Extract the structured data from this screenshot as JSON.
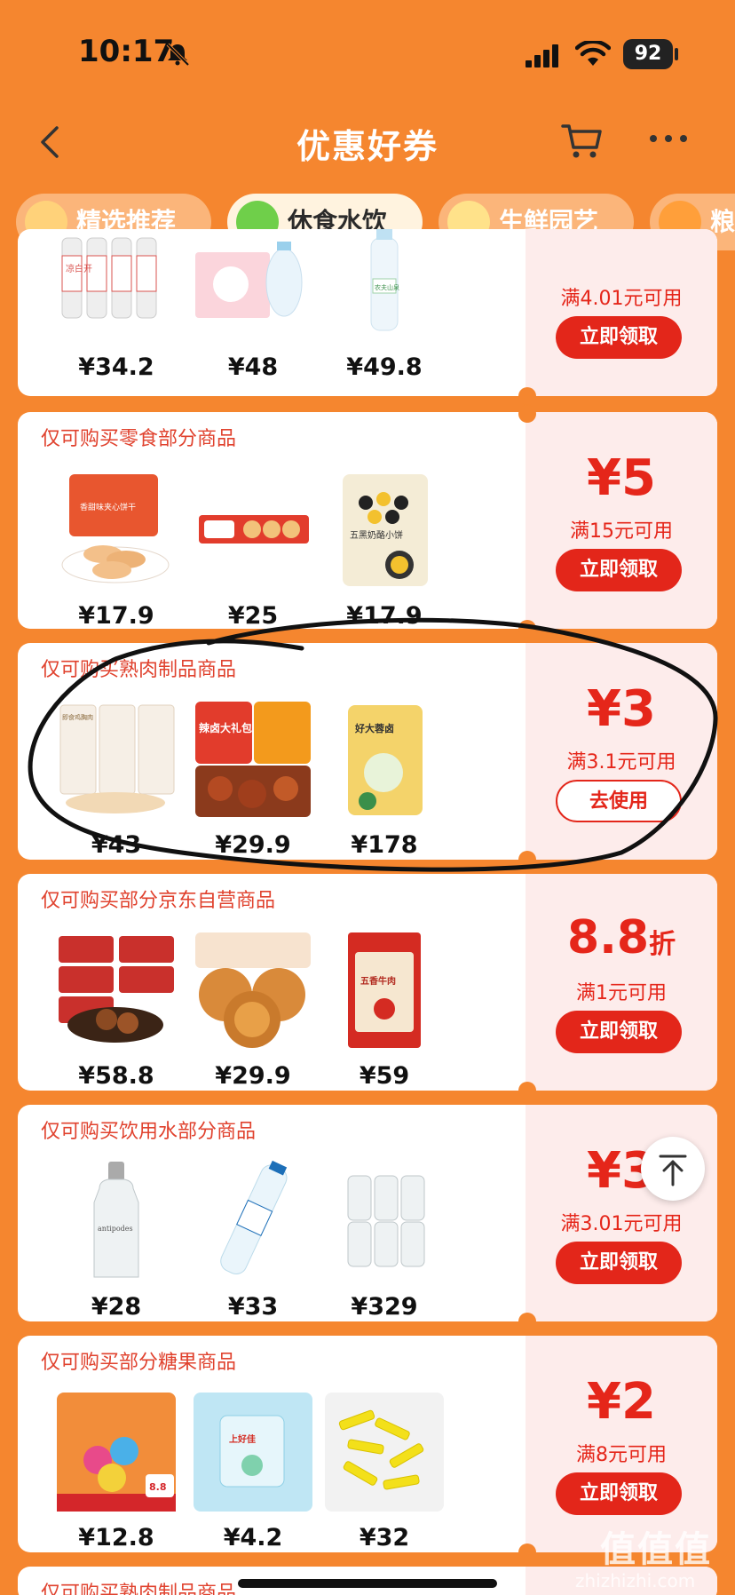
{
  "status_bar": {
    "time": "10:17",
    "battery": "92"
  },
  "nav": {
    "title": "优惠好券"
  },
  "tabs": [
    {
      "label": "精选推荐",
      "active": false
    },
    {
      "label": "休食水饮",
      "active": true
    },
    {
      "label": "生鲜园艺",
      "active": false
    },
    {
      "label": "粮",
      "active": false
    }
  ],
  "cards": [
    {
      "title": "",
      "prices": [
        "¥34.2",
        "¥48",
        "¥49.8"
      ],
      "amount": "",
      "amount_unit": "",
      "condition": "满4.01元可用",
      "button": "立即领取",
      "button_type": "claim"
    },
    {
      "title": "仅可购买零食部分商品",
      "prices": [
        "¥17.9",
        "¥25",
        "¥17.9"
      ],
      "amount": "¥5",
      "amount_unit": "",
      "condition": "满15元可用",
      "button": "立即领取",
      "button_type": "claim"
    },
    {
      "title": "仅可购买熟肉制品商品",
      "prices": [
        "¥43",
        "¥29.9",
        "¥178"
      ],
      "amount": "¥3",
      "amount_unit": "",
      "condition": "满3.1元可用",
      "button": "去使用",
      "button_type": "use"
    },
    {
      "title": "仅可购买部分京东自营商品",
      "prices": [
        "¥58.8",
        "¥29.9",
        "¥59"
      ],
      "amount": "8.8",
      "amount_unit": "折",
      "condition": "满1元可用",
      "button": "立即领取",
      "button_type": "claim"
    },
    {
      "title": "仅可购买饮用水部分商品",
      "prices": [
        "¥28",
        "¥33",
        "¥329"
      ],
      "amount": "¥3",
      "amount_unit": "",
      "condition": "满3.01元可用",
      "button": "立即领取",
      "button_type": "claim"
    },
    {
      "title": "仅可购买部分糖果商品",
      "prices": [
        "¥12.8",
        "¥4.2",
        "¥32"
      ],
      "amount": "¥2",
      "amount_unit": "",
      "condition": "满8元可用",
      "button": "立即领取",
      "button_type": "claim"
    },
    {
      "title": "仅可购买熟肉制品商品",
      "prices": [],
      "amount": "",
      "amount_unit": "",
      "condition": "",
      "button": "",
      "button_type": ""
    }
  ],
  "product_labels": {
    "c0p0": "凉白开",
    "c0p2": "农夫山泉",
    "c1p0": "香甜味夹心饼干",
    "c1p2": "五黑奶酪小饼",
    "c2p0": "即食鸡胸肉",
    "c2p1": "辣卤大礼包",
    "c2p2": "好大蓉卤",
    "c3p2": "五香牛肉",
    "c4p0": "antipodes",
    "c5p0": "8.8",
    "c5p1": "上好佳"
  },
  "colors": {
    "background": "#f5862f",
    "accent": "#e3261a",
    "coupon_panel": "#fdeceb"
  },
  "watermark": {
    "text": "值值值",
    "sub": "zhizhizhi.com"
  },
  "icons": {
    "back": "back-arrow-icon",
    "cart": "cart-icon",
    "more": "more-icon",
    "scroll_top": "scroll-top-icon"
  }
}
